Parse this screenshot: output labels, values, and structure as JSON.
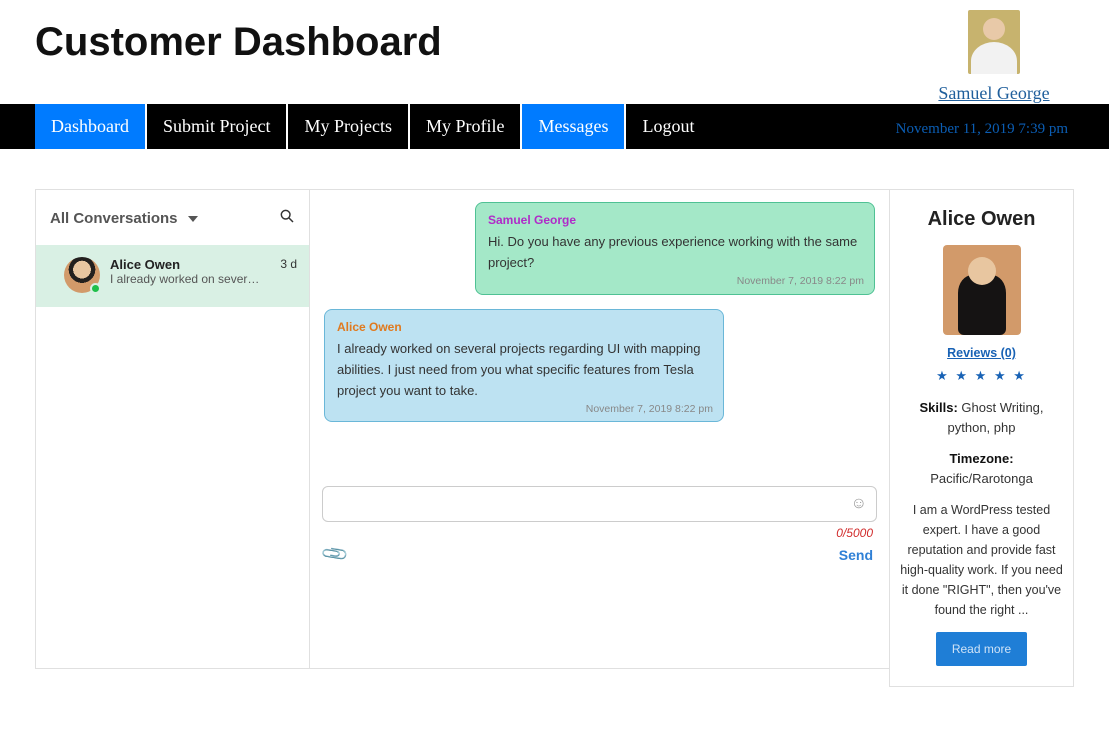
{
  "header": {
    "title": "Customer Dashboard",
    "user_name": "Samuel George",
    "datetime": "November 11, 2019 7:39 pm"
  },
  "nav": {
    "dashboard": "Dashboard",
    "submit": "Submit Project",
    "projects": "My Projects",
    "profile": "My Profile",
    "messages": "Messages",
    "logout": "Logout"
  },
  "conversations": {
    "title": "All Conversations",
    "item": {
      "name": "Alice Owen",
      "preview": "I already worked on sever…",
      "age": "3 d"
    }
  },
  "chat": {
    "msg1": {
      "sender": "Samuel George",
      "text": "Hi. Do you have any previous experience working with the same project?",
      "time": "November 7, 2019 8:22 pm"
    },
    "msg2": {
      "sender": "Alice Owen",
      "text": "I already worked on several projects regarding UI with mapping abilities. I just need from you what specific features from Tesla project you want to take.",
      "time": "November 7, 2019 8:22 pm"
    },
    "char_count": "0/5000",
    "send": "Send"
  },
  "profile": {
    "name": "Alice Owen",
    "reviews": "Reviews (0)",
    "stars": "★ ★ ★ ★ ★",
    "skills_label": "Skills:",
    "skills": " Ghost Writing, python, php",
    "tz_label": "Timezone:",
    "tz": " Pacific/Rarotonga",
    "bio": "I am a WordPress tested expert. I have a good reputation and provide fast high-quality work. If you need it done \"RIGHT\", then you've found the right ...",
    "read_more": "Read more"
  }
}
